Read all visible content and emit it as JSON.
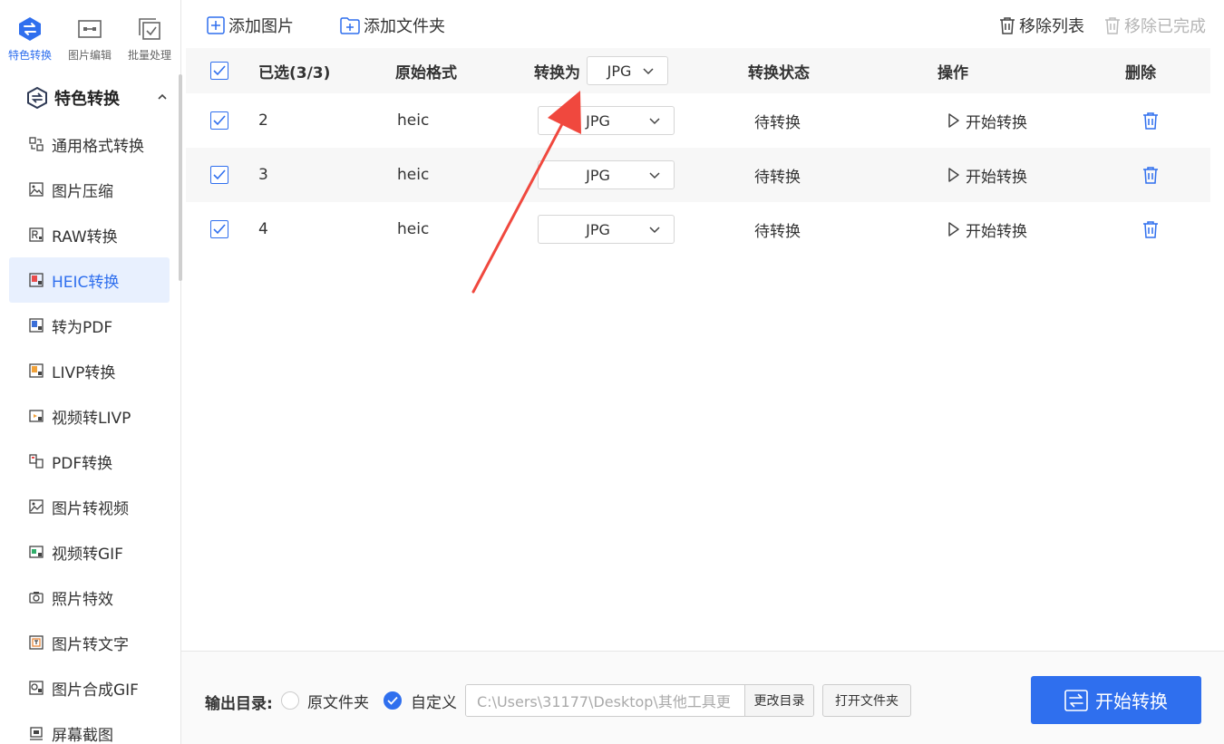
{
  "sidebar": {
    "mode_tabs": [
      {
        "label": "特色转换",
        "icon": "swap-icon",
        "active": true
      },
      {
        "label": "图片编辑",
        "icon": "image-edit-icon",
        "active": false
      },
      {
        "label": "批量处理",
        "icon": "batch-icon",
        "active": false
      }
    ],
    "group_title": "特色转换",
    "items": [
      {
        "label": "通用格式转换",
        "icon": "format-convert-icon"
      },
      {
        "label": "图片压缩",
        "icon": "image-compress-icon"
      },
      {
        "label": "RAW转换",
        "icon": "raw-icon"
      },
      {
        "label": "HEIC转换",
        "icon": "heic-icon",
        "active": true
      },
      {
        "label": "转为PDF",
        "icon": "pdf-icon"
      },
      {
        "label": "LIVP转换",
        "icon": "livp-icon"
      },
      {
        "label": "视频转LIVP",
        "icon": "video-livp-icon"
      },
      {
        "label": "PDF转换",
        "icon": "pdf-convert-icon"
      },
      {
        "label": "图片转视频",
        "icon": "image-video-icon"
      },
      {
        "label": "视频转GIF",
        "icon": "video-gif-icon"
      },
      {
        "label": "照片特效",
        "icon": "camera-icon"
      },
      {
        "label": "图片转文字",
        "icon": "ocr-icon"
      },
      {
        "label": "图片合成GIF",
        "icon": "gif-merge-icon"
      },
      {
        "label": "屏幕截图",
        "icon": "screenshot-icon"
      }
    ]
  },
  "toolbar": {
    "add_image": "添加图片",
    "add_folder": "添加文件夹",
    "remove_list": "移除列表",
    "remove_done": "移除已完成"
  },
  "table": {
    "headers": {
      "selected": "已选(3/3)",
      "format": "原始格式",
      "convert_to": "转换为",
      "convert_to_value": "JPG",
      "status": "转换状态",
      "action": "操作",
      "delete": "删除"
    },
    "rows": [
      {
        "index": "2",
        "format": "heic",
        "target": "JPG",
        "status": "待转换",
        "action": "开始转换"
      },
      {
        "index": "3",
        "format": "heic",
        "target": "JPG",
        "status": "待转换",
        "action": "开始转换"
      },
      {
        "index": "4",
        "format": "heic",
        "target": "JPG",
        "status": "待转换",
        "action": "开始转换"
      }
    ]
  },
  "footer": {
    "output_label": "输出目录:",
    "option_original": "原文件夹",
    "option_custom": "自定义",
    "path_value": "C:\\Users\\31177\\Desktop\\其他工具更",
    "change_dir": "更改目录",
    "open_folder": "打开文件夹",
    "start": "开始转换"
  },
  "colors": {
    "accent": "#2f6fee",
    "annotation": "#f0483e"
  }
}
